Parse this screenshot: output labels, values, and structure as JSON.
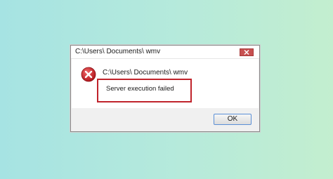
{
  "window": {
    "title": "C:\\Users\\ Documents\\  wmv"
  },
  "message": {
    "path": "C:\\Users\\ Documents\\  wmv",
    "error": "Server execution failed"
  },
  "buttons": {
    "ok_label": "OK"
  },
  "colors": {
    "error_icon": "#c0232b",
    "highlight_border": "#c0232b",
    "close_button": "#c75050"
  },
  "icons": {
    "error": "error-x-icon",
    "close": "close-icon"
  }
}
